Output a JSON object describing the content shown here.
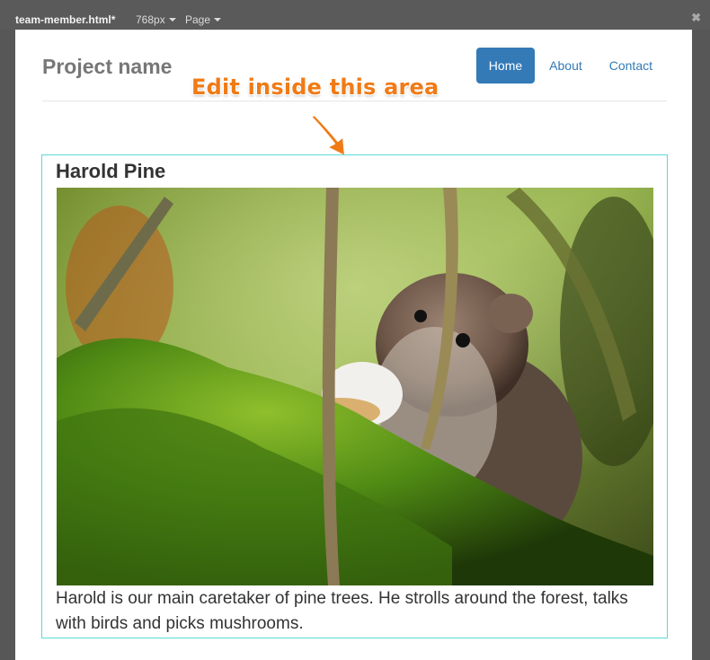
{
  "toolbar": {
    "file_name": "team-member.html*",
    "width_label": "768px",
    "page_label": "Page",
    "close_symbol": "✖"
  },
  "navbar": {
    "brand": "Project name",
    "items": [
      {
        "label": "Home",
        "active": true
      },
      {
        "label": "About",
        "active": false
      },
      {
        "label": "Contact",
        "active": false
      }
    ]
  },
  "hint": {
    "text": "Edit inside this area",
    "color": "#f07b16"
  },
  "member": {
    "name": "Harold Pine",
    "photo_icon": "mouse-in-moss-photo",
    "bio": "Harold is our main caretaker of pine trees. He strolls around the forest, talks with birds and picks mushrooms."
  },
  "colors": {
    "accent": "#337ab7",
    "edit_outline": "#5fd8d8"
  }
}
